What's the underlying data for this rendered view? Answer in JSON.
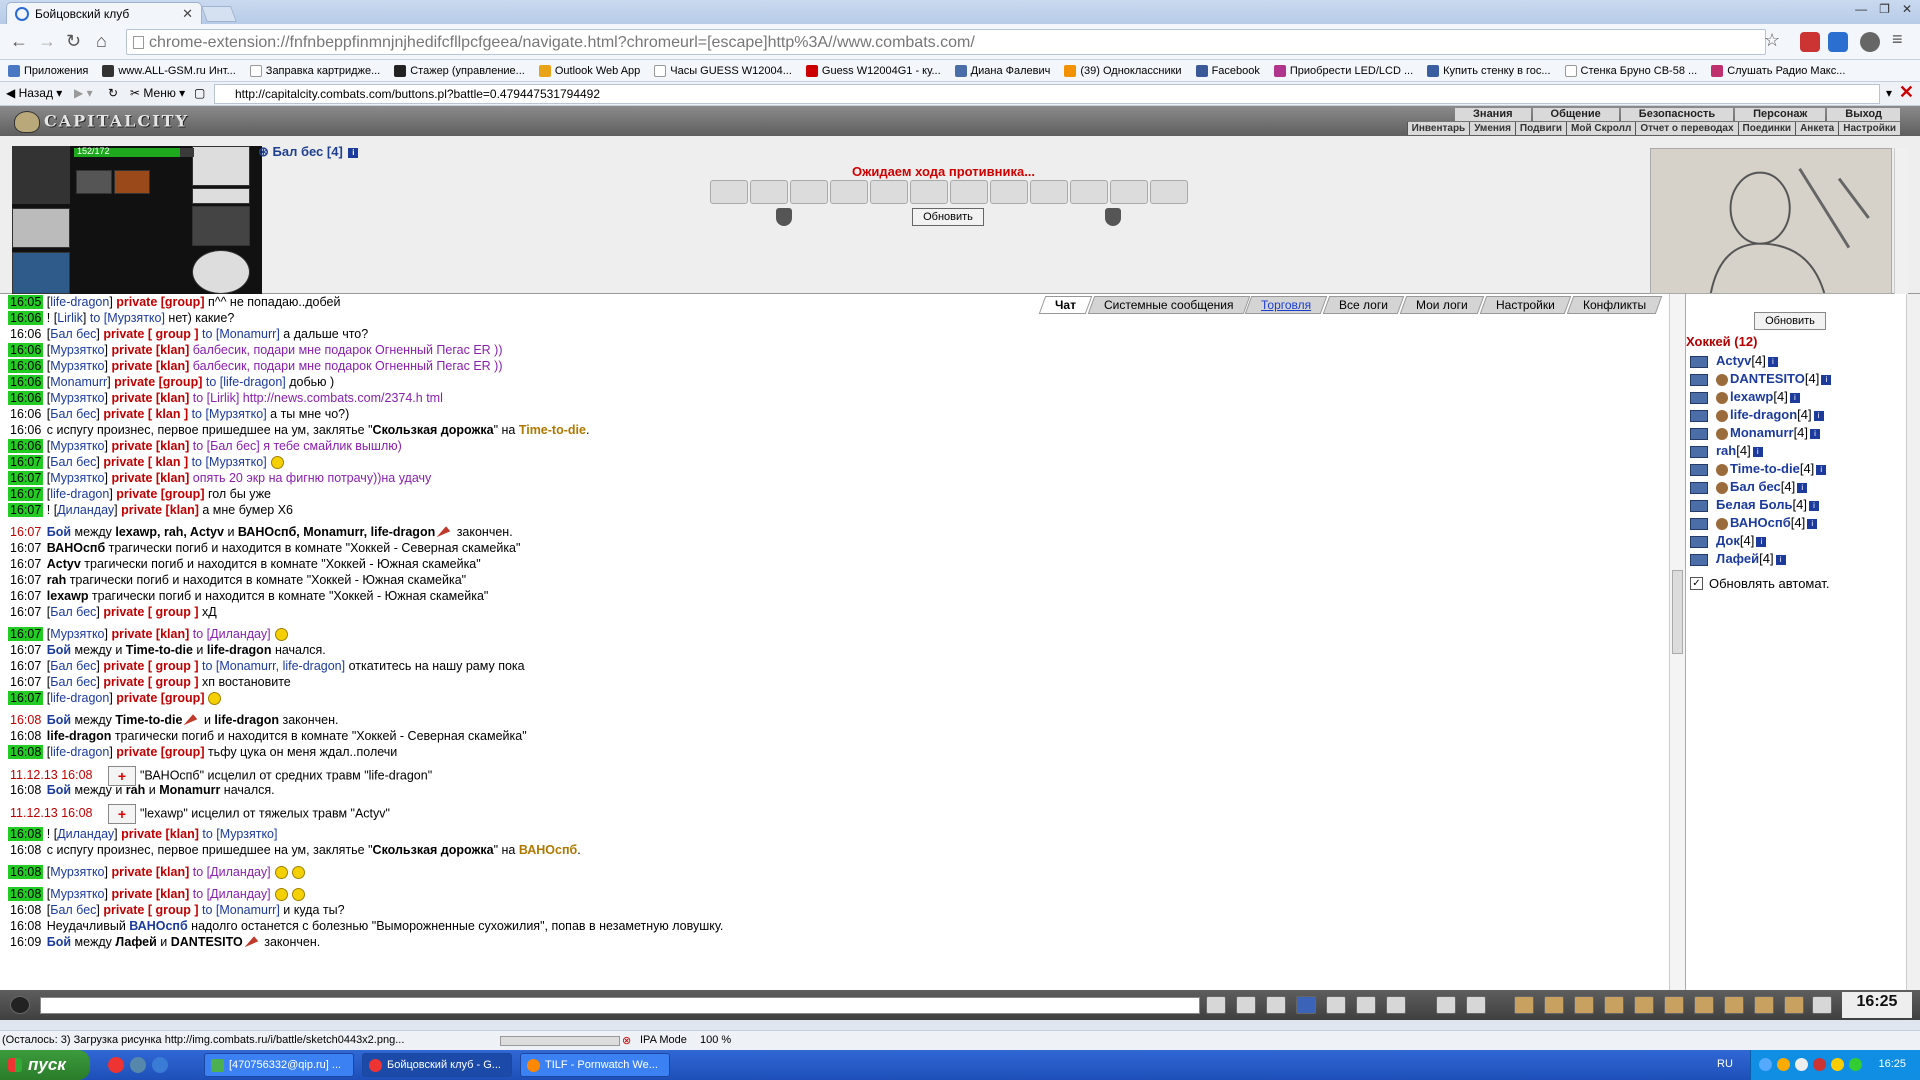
{
  "browser": {
    "tab_title": "Бойцовский клуб",
    "url": "chrome-extension://fnfnbeppfinmnjnjhedifcfllpcfgeea/navigate.html?chromeurl=[escape]http%3A//www.combats.com/",
    "bookmarks": [
      "Приложения",
      "www.ALL-GSM.ru Инт...",
      "Заправка картридже...",
      "Стажер (управление...",
      "Outlook Web App",
      "Часы GUESS W12004...",
      "Guess W12004G1 - ку...",
      "Диана Фалевич",
      "(39) Одноклассники",
      "Facebook",
      "Приобрести LED/LCD ...",
      "Купить стенку в гос...",
      "Стенка Бруно СВ-58 ...",
      "Слушать Радио Макс..."
    ],
    "ie_back_label": "Назад",
    "ie_menu_label": "Меню",
    "ie_address": "http://capitalcity.combats.com/buttons.pl?battle=0.479447531794492",
    "status_text": "(Осталось: 3) Загрузка рисунка http://img.combats.ru/i/battle/sketch0443x2.png...",
    "ipa_mode": "IPA Mode",
    "zoom": "100 %"
  },
  "game": {
    "logo": "CAPITALCITY",
    "main_menu": [
      "Знания",
      "Общение",
      "Безопасность",
      "Персонаж",
      "Выход"
    ],
    "sub_menu": [
      "Инвентарь",
      "Умения",
      "Подвиги",
      "Мой Скролл",
      "Отчет о переводах",
      "Поединки",
      "Анкета",
      "Настройки"
    ],
    "hp": "152/172",
    "hp_fraction": 0.8837,
    "enemy": "Бал бес [4]",
    "waiting": "Ожидаем хода противника...",
    "refresh_label": "Обновить",
    "clock": "16:25"
  },
  "chat": {
    "tabs": [
      "Чат",
      "Системные сообщения",
      "Торговля",
      "Все логи",
      "Мои логи",
      "Настройки",
      "Конфликты"
    ],
    "messages": [
      {
        "ts": "16:05",
        "hl": true,
        "parts": [
          [
            "txt",
            "["
          ],
          [
            "nm",
            "life-dragon"
          ],
          [
            "txt",
            "] "
          ],
          [
            "priv",
            "private [group]"
          ],
          [
            "txt",
            " п^^ не попадаю..добей"
          ]
        ]
      },
      {
        "ts": "16:06",
        "hl": true,
        "parts": [
          [
            "txt",
            "! ["
          ],
          [
            "nm",
            "Lirlik"
          ],
          [
            "txt",
            "] "
          ],
          [
            "to",
            "to [Мурзятко]"
          ],
          [
            "txt",
            " нет) какие?"
          ]
        ]
      },
      {
        "ts": "16:06",
        "hl": false,
        "parts": [
          [
            "txt",
            "["
          ],
          [
            "nm",
            "Бал бес"
          ],
          [
            "txt",
            "] "
          ],
          [
            "priv",
            "private [ group ]"
          ],
          [
            "to",
            " to [Monamurr]"
          ],
          [
            "txt",
            " а дальше что?"
          ]
        ]
      },
      {
        "ts": "16:06",
        "hl": true,
        "parts": [
          [
            "txt",
            "["
          ],
          [
            "nm",
            "Мурзятко"
          ],
          [
            "txt",
            "] "
          ],
          [
            "priv",
            "private [klan]"
          ],
          [
            "purple",
            " балбесик, подари мне подарок Огненный Пегас ER ))"
          ]
        ]
      },
      {
        "ts": "16:06",
        "hl": true,
        "parts": [
          [
            "txt",
            "["
          ],
          [
            "nm",
            "Мурзятко"
          ],
          [
            "txt",
            "] "
          ],
          [
            "priv",
            "private [klan]"
          ],
          [
            "purple",
            " балбесик, подари мне подарок Огненный Пегас ER ))"
          ]
        ]
      },
      {
        "ts": "16:06",
        "hl": true,
        "parts": [
          [
            "txt",
            "["
          ],
          [
            "nm",
            "Monamurr"
          ],
          [
            "txt",
            "] "
          ],
          [
            "priv",
            "private [group]"
          ],
          [
            "to",
            " to [life-dragon]"
          ],
          [
            "txt",
            " добью )"
          ]
        ]
      },
      {
        "ts": "16:06",
        "hl": true,
        "parts": [
          [
            "txt",
            "["
          ],
          [
            "nm",
            "Мурзятко"
          ],
          [
            "txt",
            "] "
          ],
          [
            "priv",
            "private [klan]"
          ],
          [
            "purple",
            " to [Lirlik] http://news.combats.com/2374.h tml"
          ]
        ]
      },
      {
        "ts": "16:06",
        "hl": false,
        "parts": [
          [
            "txt",
            "["
          ],
          [
            "nm",
            "Бал бес"
          ],
          [
            "txt",
            "] "
          ],
          [
            "priv",
            "private [ klan ]"
          ],
          [
            "to",
            " to [Мурзятко]"
          ],
          [
            "txt",
            " а ты мне чо?)"
          ]
        ]
      },
      {
        "ts": "16:06",
        "hl": false,
        "parts": [
          [
            "txt",
            "с испугу произнес, первое пришедшее на ум, заклятье \""
          ],
          [
            "bold",
            "Скользкая дорожка"
          ],
          [
            "txt",
            "\" на "
          ],
          [
            "spell",
            "Time-to-die"
          ],
          [
            "txt",
            "."
          ]
        ]
      },
      {
        "ts": "16:06",
        "hl": true,
        "parts": [
          [
            "txt",
            "["
          ],
          [
            "nm",
            "Мурзятко"
          ],
          [
            "txt",
            "] "
          ],
          [
            "priv",
            "private [klan]"
          ],
          [
            "purple",
            " to [Бал бес] я тебе смайлик вышлю)"
          ]
        ]
      },
      {
        "ts": "16:07",
        "hl": true,
        "parts": [
          [
            "txt",
            "["
          ],
          [
            "nm",
            "Бал бес"
          ],
          [
            "txt",
            "] "
          ],
          [
            "priv",
            "private [ klan ]"
          ],
          [
            "to",
            " to [Мурзятко]"
          ],
          [
            "smile",
            ""
          ]
        ]
      },
      {
        "ts": "16:07",
        "hl": true,
        "parts": [
          [
            "txt",
            "["
          ],
          [
            "nm",
            "Мурзятко"
          ],
          [
            "txt",
            "] "
          ],
          [
            "priv",
            "private [klan]"
          ],
          [
            "purple",
            " опять 20 экр на фигню потрачу))на удачу"
          ]
        ]
      },
      {
        "ts": "16:07",
        "hl": true,
        "parts": [
          [
            "txt",
            "["
          ],
          [
            "nm",
            "life-dragon"
          ],
          [
            "txt",
            "] "
          ],
          [
            "priv",
            "private [group]"
          ],
          [
            "txt",
            " гол бы уже"
          ]
        ]
      },
      {
        "ts": "16:07",
        "hl": true,
        "parts": [
          [
            "txt",
            "! ["
          ],
          [
            "nm",
            "Диландау"
          ],
          [
            "txt",
            "] "
          ],
          [
            "priv",
            "private [klan]"
          ],
          [
            "txt",
            " а мне бумер Х6"
          ]
        ]
      },
      {
        "ts": "16:07",
        "hl": false,
        "red": true,
        "gap": true,
        "parts": [
          [
            "bold nm",
            "Бой"
          ],
          [
            "txt",
            " между "
          ],
          [
            "bold",
            "lexawp, rah, Actyv"
          ],
          [
            "txt",
            " и "
          ],
          [
            "bold",
            "ВАНОспб, Monamurr, life-dragon"
          ],
          [
            "sword",
            ""
          ],
          [
            "txt",
            " закончен."
          ]
        ]
      },
      {
        "ts": "16:07",
        "hl": false,
        "parts": [
          [
            "bold",
            "ВАНОспб"
          ],
          [
            "txt",
            " трагически погиб и находится в комнате \"Хоккей - Северная скамейка\""
          ]
        ]
      },
      {
        "ts": "16:07",
        "hl": false,
        "parts": [
          [
            "bold",
            "Actyv"
          ],
          [
            "txt",
            " трагически погиб и находится в комнате \"Хоккей - Южная скамейка\""
          ]
        ]
      },
      {
        "ts": "16:07",
        "hl": false,
        "parts": [
          [
            "bold",
            "rah"
          ],
          [
            "txt",
            " трагически погиб и находится в комнате \"Хоккей - Южная скамейка\""
          ]
        ]
      },
      {
        "ts": "16:07",
        "hl": false,
        "parts": [
          [
            "bold",
            "lexawp"
          ],
          [
            "txt",
            " трагически погиб и находится в комнате \"Хоккей - Южная скамейка\""
          ]
        ]
      },
      {
        "ts": "16:07",
        "hl": false,
        "parts": [
          [
            "txt",
            "["
          ],
          [
            "nm",
            "Бал бес"
          ],
          [
            "txt",
            "] "
          ],
          [
            "priv",
            "private [ group ]"
          ],
          [
            "txt",
            " хД"
          ]
        ]
      },
      {
        "ts": "16:07",
        "hl": true,
        "gap": true,
        "parts": [
          [
            "txt",
            "["
          ],
          [
            "nm",
            "Мурзятко"
          ],
          [
            "txt",
            "] "
          ],
          [
            "priv",
            "private [klan]"
          ],
          [
            "purple",
            " to [Диландау]"
          ],
          [
            "smile",
            ""
          ]
        ]
      },
      {
        "ts": "16:07",
        "hl": false,
        "parts": [
          [
            "bold nm",
            "Бой"
          ],
          [
            "txt",
            " между и "
          ],
          [
            "bold",
            "Time-to-die"
          ],
          [
            "txt",
            " и "
          ],
          [
            "bold",
            "life-dragon"
          ],
          [
            "txt",
            " начался."
          ]
        ]
      },
      {
        "ts": "16:07",
        "hl": false,
        "parts": [
          [
            "txt",
            "["
          ],
          [
            "nm",
            "Бал бес"
          ],
          [
            "txt",
            "] "
          ],
          [
            "priv",
            "private [ group ]"
          ],
          [
            "to",
            " to [Monamurr, life-dragon]"
          ],
          [
            "txt",
            " откатитесь на нашу раму пока"
          ]
        ]
      },
      {
        "ts": "16:07",
        "hl": false,
        "parts": [
          [
            "txt",
            "["
          ],
          [
            "nm",
            "Бал бес"
          ],
          [
            "txt",
            "] "
          ],
          [
            "priv",
            "private [ group ]"
          ],
          [
            "txt",
            " хп востановите"
          ]
        ]
      },
      {
        "ts": "16:07",
        "hl": true,
        "parts": [
          [
            "txt",
            "["
          ],
          [
            "nm",
            "life-dragon"
          ],
          [
            "txt",
            "] "
          ],
          [
            "priv",
            "private [group]"
          ],
          [
            "smile",
            ""
          ]
        ]
      },
      {
        "ts": "16:08",
        "hl": false,
        "red": true,
        "gap": true,
        "parts": [
          [
            "bold nm",
            "Бой"
          ],
          [
            "txt",
            " между "
          ],
          [
            "bold",
            "Time-to-die"
          ],
          [
            "sword",
            ""
          ],
          [
            "txt",
            " и "
          ],
          [
            "bold",
            "life-dragon"
          ],
          [
            "txt",
            " закончен."
          ]
        ]
      },
      {
        "ts": "16:08",
        "hl": false,
        "parts": [
          [
            "bold",
            "life-dragon"
          ],
          [
            "txt",
            " трагически погиб и находится в комнате \"Хоккей - Северная скамейка\""
          ]
        ]
      },
      {
        "ts": "16:08",
        "hl": true,
        "parts": [
          [
            "txt",
            "["
          ],
          [
            "nm",
            "life-dragon"
          ],
          [
            "txt",
            "] "
          ],
          [
            "priv",
            "private [group]"
          ],
          [
            "txt",
            " тьфу цука он меня ждал..полечи"
          ]
        ]
      },
      {
        "ts": "11.12.13 16:08",
        "hl": false,
        "red": true,
        "gap": true,
        "parts": [
          [
            "heal",
            ""
          ],
          [
            "txt",
            "\"ВАНОспб\" исцелил от средних травм \"life-dragon\""
          ]
        ]
      },
      {
        "ts": "16:08",
        "hl": false,
        "parts": [
          [
            "bold nm",
            "Бой"
          ],
          [
            "txt",
            " между и "
          ],
          [
            "bold",
            "rah"
          ],
          [
            "txt",
            " и "
          ],
          [
            "bold",
            "Monamurr"
          ],
          [
            "txt",
            " начался."
          ]
        ]
      },
      {
        "ts": "11.12.13 16:08",
        "hl": false,
        "red": true,
        "gap": true,
        "parts": [
          [
            "heal",
            ""
          ],
          [
            "txt",
            "\"lexawp\" исцелил от тяжелых травм \"Actyv\""
          ]
        ]
      },
      {
        "ts": "16:08",
        "hl": true,
        "gap": true,
        "parts": [
          [
            "txt",
            "! ["
          ],
          [
            "nm",
            "Диландау"
          ],
          [
            "txt",
            "] "
          ],
          [
            "priv",
            "private [klan]"
          ],
          [
            "to",
            " to [Мурзятко]"
          ]
        ]
      },
      {
        "ts": "16:08",
        "hl": false,
        "parts": [
          [
            "txt",
            "с испугу произнес, первое пришедшее на ум, заклятье \""
          ],
          [
            "bold",
            "Скользкая дорожка"
          ],
          [
            "txt",
            "\" на "
          ],
          [
            "spell",
            "ВАНОспб"
          ],
          [
            "txt",
            "."
          ]
        ]
      },
      {
        "ts": "16:08",
        "hl": true,
        "gap": true,
        "parts": [
          [
            "txt",
            "["
          ],
          [
            "nm",
            "Мурзятко"
          ],
          [
            "txt",
            "] "
          ],
          [
            "priv",
            "private [klan]"
          ],
          [
            "purple",
            " to [Диландау]"
          ],
          [
            "smile",
            ""
          ],
          [
            "smile",
            ""
          ]
        ]
      },
      {
        "ts": "16:08",
        "hl": true,
        "gap": true,
        "parts": [
          [
            "txt",
            "["
          ],
          [
            "nm",
            "Мурзятко"
          ],
          [
            "txt",
            "] "
          ],
          [
            "priv",
            "private [klan]"
          ],
          [
            "purple",
            " to [Диландау]"
          ],
          [
            "smile",
            ""
          ],
          [
            "smile",
            ""
          ]
        ]
      },
      {
        "ts": "16:08",
        "hl": false,
        "parts": [
          [
            "txt",
            "["
          ],
          [
            "nm",
            "Бал бес"
          ],
          [
            "txt",
            "] "
          ],
          [
            "priv",
            "private [ group ]"
          ],
          [
            "to",
            " to [Monamurr]"
          ],
          [
            "txt",
            " и куда ты?"
          ]
        ]
      },
      {
        "ts": "16:08",
        "hl": false,
        "parts": [
          [
            "txt",
            "Неудачливый "
          ],
          [
            "bold nm",
            "ВАНОспб"
          ],
          [
            "txt",
            " надолго останется с болезнью \"Выморожненные сухожилия\", попав в незаметную ловушку."
          ]
        ]
      },
      {
        "ts": "16:09",
        "hl": false,
        "parts": [
          [
            "bold nm",
            "Бой"
          ],
          [
            "txt",
            " между "
          ],
          [
            "bold",
            "Лафей"
          ],
          [
            "txt",
            " и "
          ],
          [
            "bold",
            "DANTESITO"
          ],
          [
            "sword",
            ""
          ],
          [
            "txt",
            " закончен."
          ]
        ]
      }
    ]
  },
  "room": {
    "title": "Хоккей (12)",
    "players": [
      {
        "name": "Actyv",
        "level": "[4]",
        "clan": false
      },
      {
        "name": "DANTESITO",
        "level": "[4]",
        "clan": true
      },
      {
        "name": "lexawp",
        "level": "[4]",
        "clan": true
      },
      {
        "name": "life-dragon",
        "level": "[4]",
        "clan": true
      },
      {
        "name": "Monamurr",
        "level": "[4]",
        "clan": true
      },
      {
        "name": "rah",
        "level": "[4]",
        "clan": false
      },
      {
        "name": "Time-to-die",
        "level": "[4]",
        "clan": true
      },
      {
        "name": "Бал бес",
        "level": "[4]",
        "clan": true
      },
      {
        "name": "Белая Боль",
        "level": "[4]",
        "clan": false
      },
      {
        "name": "ВАНОспб",
        "level": "[4]",
        "clan": true
      },
      {
        "name": "Док",
        "level": "[4]",
        "clan": false
      },
      {
        "name": "Лафей",
        "level": "[4]",
        "clan": false
      }
    ],
    "auto_refresh_label": "Обновлять автомат."
  },
  "taskbar": {
    "start": "пуск",
    "tasks": [
      "[470756332@qip.ru] ...",
      "Бойцовский клуб - G...",
      "TILF - Pornwatch We..."
    ],
    "lang": "RU",
    "time": "16:25"
  },
  "colors": {
    "highlight": "#22cc22",
    "private": "#c00000",
    "name": "#1c3b9c",
    "room_title": "#b00000"
  }
}
